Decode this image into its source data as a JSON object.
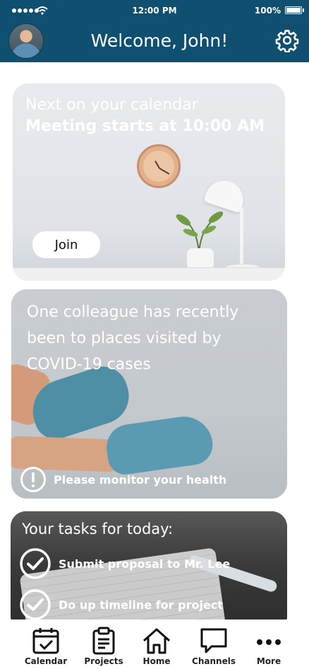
{
  "status_bar": {
    "time": "12:00 PM",
    "battery": "100%"
  },
  "header": {
    "title": "Welcome, John!"
  },
  "cards": {
    "calendar": {
      "subtitle": "Next on your calendar",
      "headline": "Meeting starts at 10:00 AM",
      "button_label": "Join"
    },
    "covid": {
      "message": "One colleague has recently been to places visited by COVID-19 cases",
      "alert": "Please monitor your health"
    },
    "tasks": {
      "title": "Your tasks for today:",
      "items": [
        {
          "label": "Submit proposal to Mr. Lee"
        },
        {
          "label": "Do up timeline for project"
        }
      ]
    }
  },
  "tabbar": {
    "items": [
      {
        "label": "Calendar",
        "icon": "calendar-icon"
      },
      {
        "label": "Projects",
        "icon": "clipboard-icon"
      },
      {
        "label": "Home",
        "icon": "home-icon"
      },
      {
        "label": "Channels",
        "icon": "chat-icon"
      },
      {
        "label": "More",
        "icon": "more-icon"
      }
    ]
  },
  "colors": {
    "header_bg": "#0f4f70",
    "text_on_dark": "#ffffff"
  }
}
